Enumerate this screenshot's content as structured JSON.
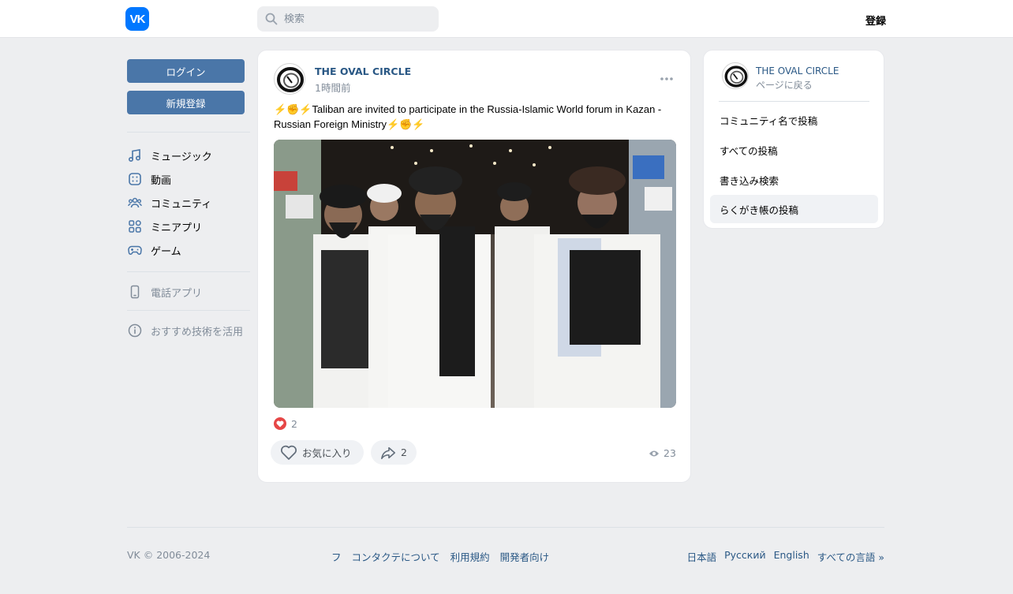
{
  "header": {
    "logo_text": "VK",
    "search_placeholder": "検索",
    "register_label": "登録"
  },
  "left_nav": {
    "login_label": "ログイン",
    "signup_label": "新規登録",
    "items": [
      {
        "label": "ミュージック",
        "icon": "music-note-icon"
      },
      {
        "label": "動画",
        "icon": "video-icon"
      },
      {
        "label": "コミュニティ",
        "icon": "community-icon"
      },
      {
        "label": "ミニアプリ",
        "icon": "mini-apps-icon"
      },
      {
        "label": "ゲーム",
        "icon": "gamepad-icon"
      }
    ],
    "phone_app_label": "電話アプリ",
    "recommend_label": "おすすめ技術を活用"
  },
  "post": {
    "author": "THE OVAL CIRCLE",
    "time": "1時間前",
    "text": "⚡✊⚡Taliban are invited to participate in the Russia-Islamic World forum in Kazan - Russian Foreign Ministry⚡✊⚡",
    "likes_count": "2",
    "favorite_label": "お気に入り",
    "share_count": "2",
    "views_count": "23"
  },
  "sidebar": {
    "community_name": "THE OVAL CIRCLE",
    "back_label": "ページに戻る",
    "items": [
      {
        "label": "コミュニティ名で投稿"
      },
      {
        "label": "すべての投稿"
      },
      {
        "label": "書き込み検索"
      },
      {
        "label": "らくがき帳の投稿"
      }
    ]
  },
  "footer": {
    "copyright": "VK © 2006-2024",
    "links": [
      "フ",
      "コンタクテについて",
      "利用規約",
      "開発者向け"
    ],
    "languages": [
      "日本語",
      "Русский",
      "English",
      "すべての言語 »"
    ]
  },
  "colors": {
    "accent": "#4a76a8",
    "link": "#2a5885",
    "brand": "#0077ff",
    "like": "#e64646"
  }
}
